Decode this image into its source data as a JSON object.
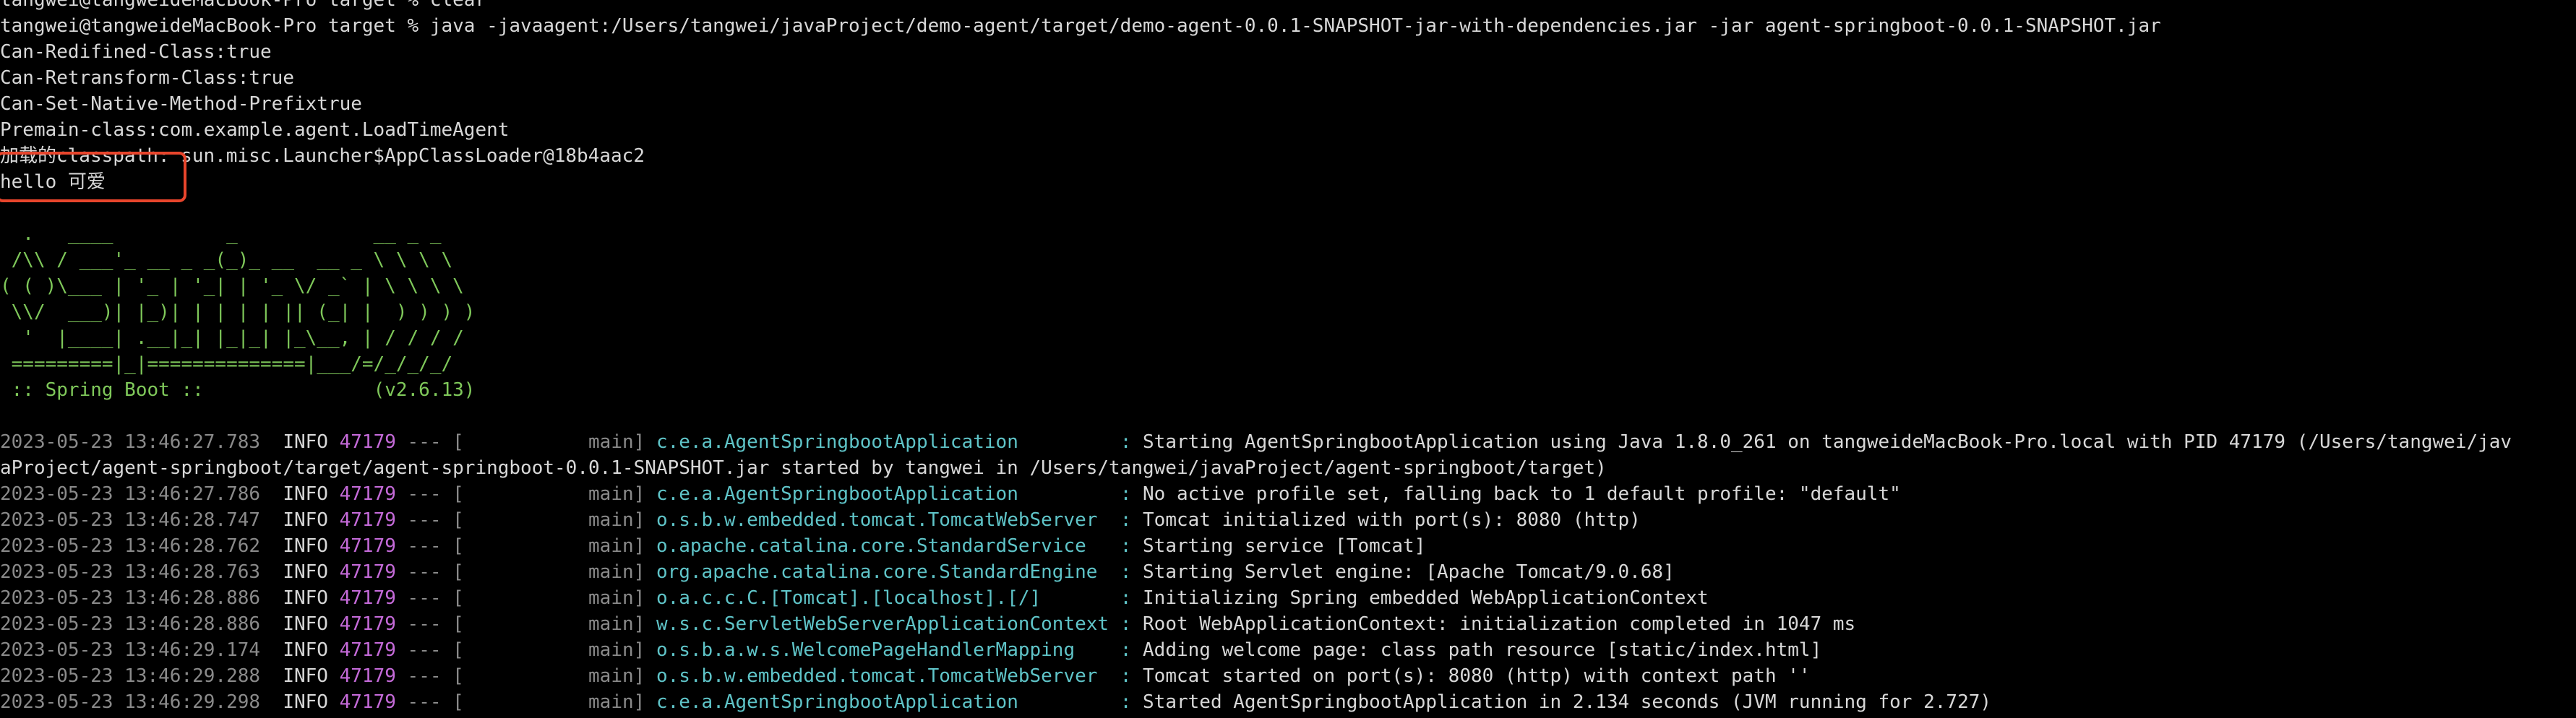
{
  "terminal": {
    "prev_line": "tangwei@tangweideMacBook-Pro target % clear",
    "command_line": "tangwei@tangweideMacBook-Pro target % java -javaagent:/Users/tangwei/javaProject/demo-agent/target/demo-agent-0.0.1-SNAPSHOT-jar-with-dependencies.jar -jar agent-springboot-0.0.1-SNAPSHOT.jar",
    "agent_output": [
      "Can-Redifined-Class:true",
      "Can-Retransform-Class:true",
      "Can-Set-Native-Method-Prefixtrue",
      "Premain-class:com.example.agent.LoadTimeAgent",
      "加载的classpath: sun.misc.Launcher$AppClassLoader@18b4aac2"
    ],
    "hello_line": "hello 可爱",
    "banner": [
      "  .   ____          _            __ _ _",
      " /\\\\ / ___'_ __ _ _(_)_ __  __ _ \\ \\ \\ \\",
      "( ( )\\___ | '_ | '_| | '_ \\/ _` | \\ \\ \\ \\",
      " \\\\/  ___)| |_)| | | | | || (_| |  ) ) ) )",
      "  '  |____| .__|_| |_|_| |_\\__, | / / / /",
      " =========|_|==============|___/=/_/_/_/"
    ],
    "spring_label": " :: Spring Boot :: ",
    "spring_version": "              (v2.6.13)",
    "logs": [
      {
        "ts": "2023-05-23 13:46:27.783",
        "level": "INFO",
        "pid": "47179",
        "sep": " --- [",
        "thread": "           main]",
        "logger": "c.e.a.AgentSpringbootApplication        ",
        "msg": "Starting AgentSpringbootApplication using Java 1.8.0_261 on tangweideMacBook-Pro.local with PID 47179 (/Users/tangwei/jav"
      },
      {
        "continuation": "aProject/agent-springboot/target/agent-springboot-0.0.1-SNAPSHOT.jar started by tangwei in /Users/tangwei/javaProject/agent-springboot/target)"
      },
      {
        "ts": "2023-05-23 13:46:27.786",
        "level": "INFO",
        "pid": "47179",
        "sep": " --- [",
        "thread": "           main]",
        "logger": "c.e.a.AgentSpringbootApplication        ",
        "msg": "No active profile set, falling back to 1 default profile: \"default\""
      },
      {
        "ts": "2023-05-23 13:46:28.747",
        "level": "INFO",
        "pid": "47179",
        "sep": " --- [",
        "thread": "           main]",
        "logger": "o.s.b.w.embedded.tomcat.TomcatWebServer ",
        "msg": "Tomcat initialized with port(s): 8080 (http)"
      },
      {
        "ts": "2023-05-23 13:46:28.762",
        "level": "INFO",
        "pid": "47179",
        "sep": " --- [",
        "thread": "           main]",
        "logger": "o.apache.catalina.core.StandardService  ",
        "msg": "Starting service [Tomcat]"
      },
      {
        "ts": "2023-05-23 13:46:28.763",
        "level": "INFO",
        "pid": "47179",
        "sep": " --- [",
        "thread": "           main]",
        "logger": "org.apache.catalina.core.StandardEngine ",
        "msg": "Starting Servlet engine: [Apache Tomcat/9.0.68]"
      },
      {
        "ts": "2023-05-23 13:46:28.886",
        "level": "INFO",
        "pid": "47179",
        "sep": " --- [",
        "thread": "           main]",
        "logger": "o.a.c.c.C.[Tomcat].[localhost].[/]      ",
        "msg": "Initializing Spring embedded WebApplicationContext"
      },
      {
        "ts": "2023-05-23 13:46:28.886",
        "level": "INFO",
        "pid": "47179",
        "sep": " --- [",
        "thread": "           main]",
        "logger": "w.s.c.ServletWebServerApplicationContext",
        "msg": "Root WebApplicationContext: initialization completed in 1047 ms"
      },
      {
        "ts": "2023-05-23 13:46:29.174",
        "level": "INFO",
        "pid": "47179",
        "sep": " --- [",
        "thread": "           main]",
        "logger": "o.s.b.a.w.s.WelcomePageHandlerMapping   ",
        "msg": "Adding welcome page: class path resource [static/index.html]"
      },
      {
        "ts": "2023-05-23 13:46:29.288",
        "level": "INFO",
        "pid": "47179",
        "sep": " --- [",
        "thread": "           main]",
        "logger": "o.s.b.w.embedded.tomcat.TomcatWebServer ",
        "msg": "Tomcat started on port(s): 8080 (http) with context path ''"
      },
      {
        "ts": "2023-05-23 13:46:29.298",
        "level": "INFO",
        "pid": "47179",
        "sep": " --- [",
        "thread": "           main]",
        "logger": "c.e.a.AgentSpringbootApplication        ",
        "msg": "Started AgentSpringbootApplication in 2.134 seconds (JVM running for 2.727)"
      }
    ]
  },
  "colors": {
    "background": "#000000",
    "text": "#d8d8d8",
    "banner": "#7fc85a",
    "pid": "#c46ad8",
    "logger": "#5fc4c8",
    "highlight_box": "#e8452c"
  }
}
